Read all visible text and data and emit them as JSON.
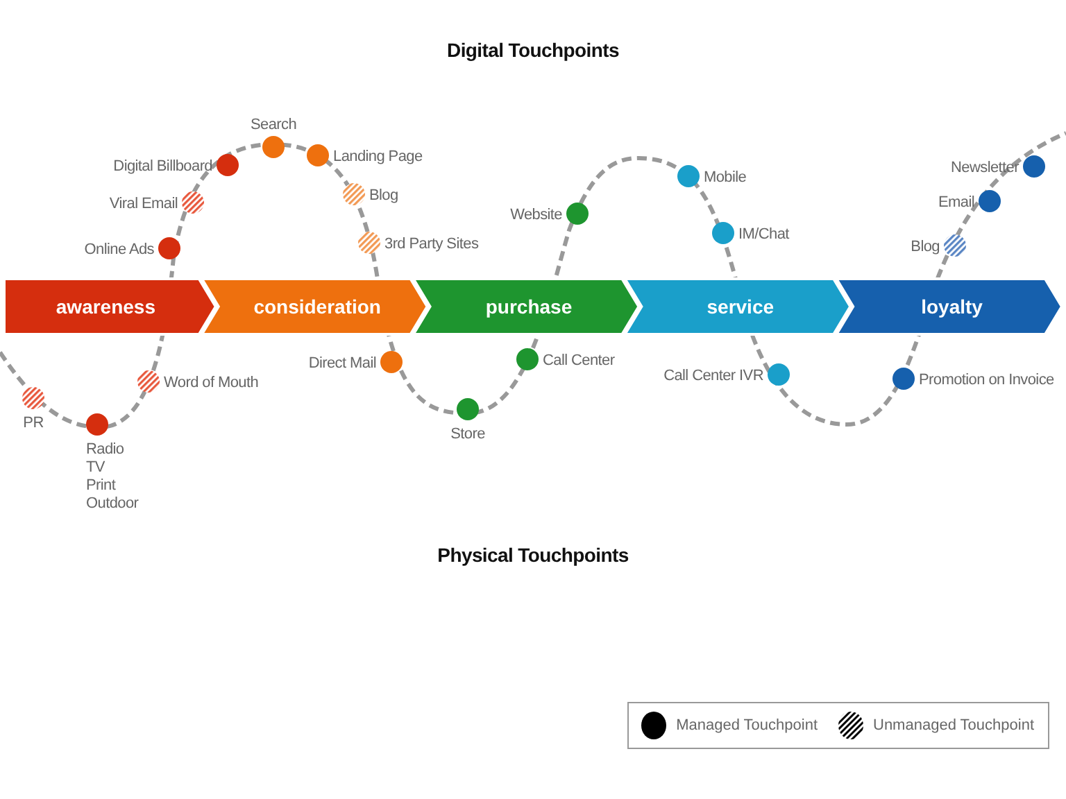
{
  "digital_title": "Digital Touchpoints",
  "stages": [
    {
      "label": "awareness",
      "color": "#d52e0e"
    },
    {
      "label": "consideration",
      "color": "#ee700e"
    },
    {
      "label": "purchase",
      "color": "#1e952f"
    },
    {
      "label": "service",
      "color": "#1a9fca"
    },
    {
      "label": "loyalty",
      "color": "#1660ad"
    }
  ],
  "digital_touchpoints": [
    {
      "lines": [
        "Digital Billboard"
      ],
      "managed": true,
      "color": "#d52e0e"
    },
    {
      "lines": [
        "Viral Email"
      ],
      "managed": false,
      "color": "#e8593e"
    },
    {
      "lines": [
        "Online Ads"
      ],
      "managed": true,
      "color": "#d52e0e"
    },
    {
      "lines": [
        "Search"
      ],
      "managed": true,
      "color": "#ee700e"
    },
    {
      "lines": [
        "Landing Page"
      ],
      "managed": true,
      "color": "#ee700e"
    },
    {
      "lines": [
        "Blog"
      ],
      "managed": false,
      "color": "#f29a55"
    },
    {
      "lines": [
        "3rd Party Sites"
      ],
      "managed": false,
      "color": "#f29a55"
    },
    {
      "lines": [
        "Website"
      ],
      "managed": true,
      "color": "#1e952f"
    },
    {
      "lines": [
        "Mobile"
      ],
      "managed": true,
      "color": "#1a9fca"
    },
    {
      "lines": [
        "IM/Chat"
      ],
      "managed": true,
      "color": "#1a9fca"
    },
    {
      "lines": [
        "Newsletter"
      ],
      "managed": true,
      "color": "#1660ad"
    },
    {
      "lines": [
        "Email"
      ],
      "managed": true,
      "color": "#1660ad"
    },
    {
      "lines": [
        "Blog"
      ],
      "managed": false,
      "color": "#5a86c4"
    }
  ],
  "physical_touchpoints": [
    {
      "lines": [
        "PR"
      ],
      "managed": false,
      "color": "#e8593e"
    },
    {
      "lines": [
        "Radio",
        "TV",
        "Print",
        "Outdoor"
      ],
      "managed": true,
      "color": "#d52e0e"
    },
    {
      "lines": [
        "Word of Mouth"
      ],
      "managed": false,
      "color": "#e8593e"
    },
    {
      "lines": [
        "Direct Mail"
      ],
      "managed": true,
      "color": "#ee700e"
    },
    {
      "lines": [
        "Store"
      ],
      "managed": true,
      "color": "#1e952f"
    },
    {
      "lines": [
        "Call Center"
      ],
      "managed": true,
      "color": "#1e952f"
    },
    {
      "lines": [
        "Call Center IVR"
      ],
      "managed": true,
      "color": "#1a9fca"
    },
    {
      "lines": [
        "Promotion on Invoice"
      ],
      "managed": true,
      "color": "#1660ad"
    }
  ],
  "physical_title": "Physical Touchpoints",
  "legend": [
    {
      "label": "Managed Touchpoint",
      "managed": true
    },
    {
      "label": "Unmanaged Touchpoint",
      "managed": false
    }
  ]
}
